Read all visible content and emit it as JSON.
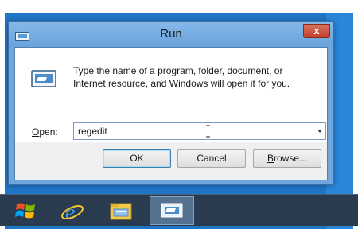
{
  "window": {
    "title": "Run",
    "close_label": "x",
    "description": "Type the name of a program, folder, document, or Internet resource, and Windows will open it for you.",
    "open_label_accel": "O",
    "open_label_rest": "pen:",
    "open_value": "regedit",
    "buttons": {
      "ok": "OK",
      "cancel": "Cancel",
      "browse_accel": "B",
      "browse_rest": "rowse..."
    }
  },
  "taskbar": {
    "items": [
      {
        "icon": "windows-logo-icon"
      },
      {
        "icon": "internet-explorer-icon"
      },
      {
        "icon": "file-explorer-icon"
      },
      {
        "icon": "run-icon",
        "active": true
      }
    ]
  },
  "colors": {
    "desktop": "#1f75c6",
    "window_frame": "#6ea6dd",
    "close_button": "#c2402a",
    "taskbar": "#2b3b4f"
  }
}
